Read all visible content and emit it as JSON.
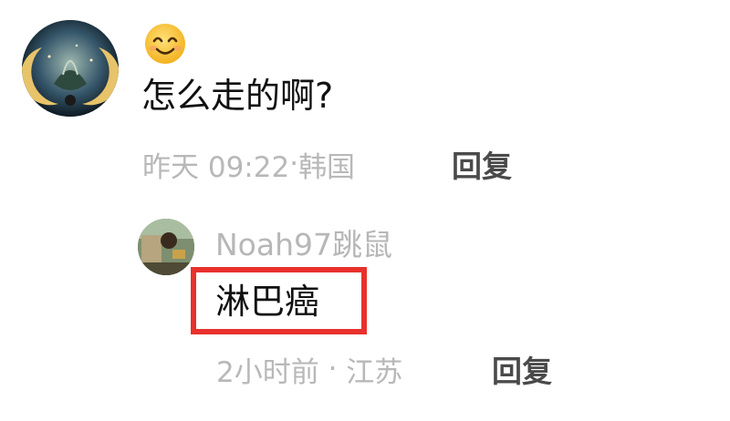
{
  "comment": {
    "emoji": "😊",
    "text": "怎么走的啊?",
    "time": "昨天 09:22",
    "separator": "·",
    "location": "韩国",
    "reply_label": "回复"
  },
  "reply": {
    "username": "Noah97跳鼠",
    "text": "淋巴癌",
    "time": "2小时前",
    "separator": " · ",
    "location": "江苏",
    "reply_label": "回复",
    "highlight_color": "#e8312c"
  }
}
